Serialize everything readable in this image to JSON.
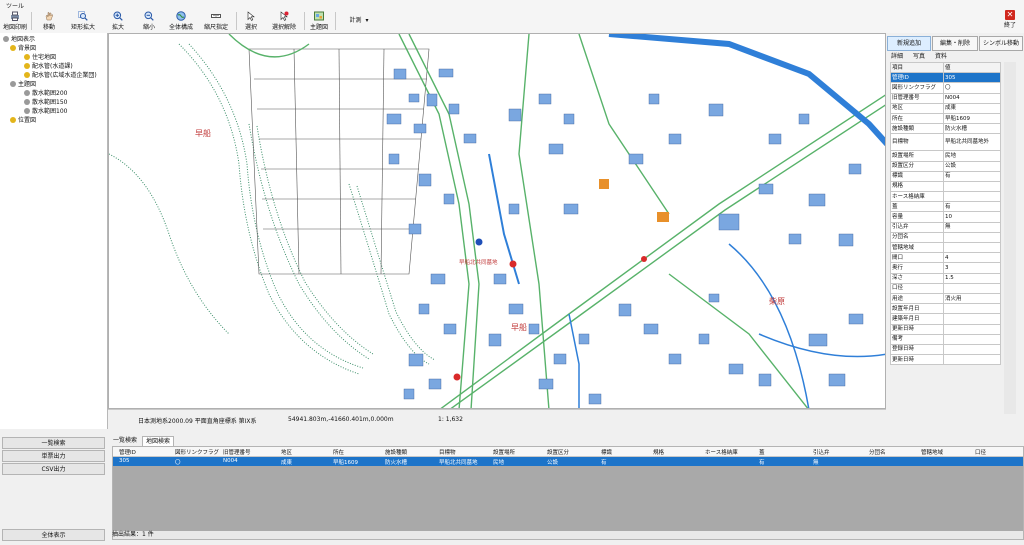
{
  "menu": {
    "label": "ツール"
  },
  "toolbar": {
    "buttons": [
      {
        "label": "地図印刷",
        "icon": "printer-icon"
      },
      {
        "label": "移動",
        "icon": "hand-icon"
      },
      {
        "label": "矩形拡大",
        "icon": "rect-zoom-icon"
      },
      {
        "label": "拡大",
        "icon": "zoom-in-icon"
      },
      {
        "label": "縮小",
        "icon": "zoom-out-icon"
      },
      {
        "label": "全体構成",
        "icon": "globe-icon"
      },
      {
        "label": "縮尺指定",
        "icon": "scale-icon"
      },
      {
        "label": "選択",
        "icon": "cursor-icon"
      },
      {
        "label": "選択解除",
        "icon": "deselect-icon"
      },
      {
        "label": "主題図",
        "icon": "theme-map-icon"
      },
      {
        "label": "計測",
        "icon": "measure-icon"
      }
    ],
    "close_label": "終了"
  },
  "tree": {
    "nodes": [
      {
        "label": "地図表示",
        "level": 0
      },
      {
        "label": "背景図",
        "level": 1
      },
      {
        "label": "住宅地図",
        "level": 2
      },
      {
        "label": "配水管(水道課)",
        "level": 2
      },
      {
        "label": "配水管(広域水道企業団)",
        "level": 2
      },
      {
        "label": "主題図",
        "level": 1
      },
      {
        "label": "散水範囲200",
        "level": 2
      },
      {
        "label": "散水範囲150",
        "level": 2
      },
      {
        "label": "散水範囲100",
        "level": 2
      },
      {
        "label": "位置図",
        "level": 1
      }
    ]
  },
  "map": {
    "labels": [
      "早船",
      "早船北共同墓地",
      "早船",
      "柴原"
    ],
    "status": {
      "crs": "日本測地系2000.09 平面直角座標系 第IX系",
      "coords": "54941.803m,-41660.401m,0.000m",
      "scale": "1: 1,632"
    },
    "colors": {
      "building": "#7aa7e0",
      "river": "#2f7fd8",
      "road_green": "#58b26a",
      "terrain": "#3c8f6a"
    }
  },
  "right_panel": {
    "tabs": [
      "新規追加",
      "編集・削除",
      "シンボル移動"
    ],
    "subtabs": [
      "詳細",
      "写真",
      "資料"
    ],
    "header": {
      "key": "項目",
      "value": "値"
    },
    "rows": [
      {
        "key": "管理ID",
        "value": "305"
      },
      {
        "key": "図形リンクフラグ",
        "value": "〇"
      },
      {
        "key": "旧管理番号",
        "value": "N004"
      },
      {
        "key": "地区",
        "value": "成東"
      },
      {
        "key": "所在",
        "value": "早船1609"
      },
      {
        "key": "施設種類",
        "value": "防火水槽"
      },
      {
        "key": "目標物",
        "value": "早船北共同墓地外"
      },
      {
        "key": "設置場所",
        "value": "民地"
      },
      {
        "key": "設置区分",
        "value": "公設"
      },
      {
        "key": "標識",
        "value": "有"
      },
      {
        "key": "規格",
        "value": ""
      },
      {
        "key": "ホース格納庫",
        "value": ""
      },
      {
        "key": "蓋",
        "value": "有"
      },
      {
        "key": "容量",
        "value": "10"
      },
      {
        "key": "引込弁",
        "value": "無"
      },
      {
        "key": "分団名",
        "value": ""
      },
      {
        "key": "管轄地域",
        "value": ""
      },
      {
        "key": "間口",
        "value": "4"
      },
      {
        "key": "奥行",
        "value": "3"
      },
      {
        "key": "深さ",
        "value": "1.5"
      },
      {
        "key": "口径",
        "value": ""
      },
      {
        "key": "用途",
        "value": "消火用"
      },
      {
        "key": "設置年月日",
        "value": ""
      },
      {
        "key": "建築年月日",
        "value": ""
      },
      {
        "key": "更新日時",
        "value": ""
      },
      {
        "key": "備考",
        "value": ""
      },
      {
        "key": "登録日時",
        "value": ""
      },
      {
        "key": "更新日時",
        "value": ""
      }
    ],
    "selected_index": 0
  },
  "bottom_left": {
    "buttons": [
      "一覧検索",
      "単票出力",
      "CSV出力"
    ],
    "show_all": "全体表示"
  },
  "bottom": {
    "tabs": [
      "一覧検索",
      "地図検索"
    ],
    "active_tab": 1,
    "columns": [
      "管理ID",
      "図形リンクフラグ",
      "旧管理番号",
      "地区",
      "所在",
      "施設種類",
      "目標物",
      "設置場所",
      "設置区分",
      "標識",
      "規格",
      "ホース格納庫",
      "蓋",
      "引込弁",
      "分団名",
      "管轄地域",
      "口径"
    ],
    "row": [
      "305",
      "〇",
      "N004",
      "成東",
      "早船1609",
      "防火水槽",
      "早船北共同墓地",
      "民地",
      "公設",
      "有",
      "",
      "",
      "有",
      "無",
      "",
      "",
      ""
    ],
    "result_label": "抽出結果：1 件"
  }
}
